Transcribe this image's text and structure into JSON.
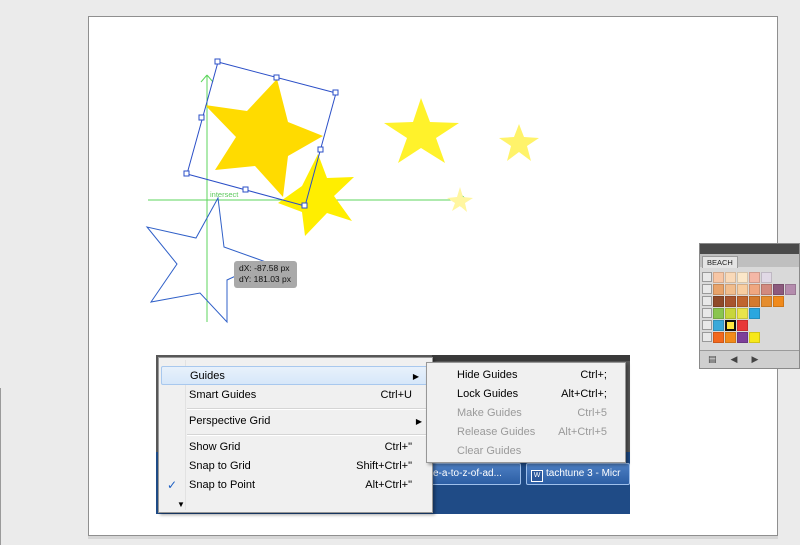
{
  "canvas": {
    "smart_guide_label": "intersect",
    "measure": {
      "dx": "dX: -87.58 px",
      "dy": "dY: 181.03 px"
    }
  },
  "swatches": {
    "tab": "BEACH",
    "rows": [
      [
        "#f7c6a5",
        "#f9d9b8",
        "#fbe7c9",
        "#f4b7a6",
        "#e1d9e6"
      ],
      [
        "#e8a36a",
        "#f1bd8d",
        "#f8cda0",
        "#f0a780",
        "#d28a7f",
        "#8c5a7d",
        "#b48cad"
      ],
      [
        "#8f4a2a",
        "#a8552f",
        "#c0652e",
        "#d37a2e",
        "#e58d2f",
        "#f08a1c"
      ],
      [
        "#8ac54f",
        "#c8d63b",
        "#e9e44b",
        "#2aa7df"
      ],
      [
        "#3aa9d9",
        "#ffe640",
        "#e83838"
      ],
      [
        "#f2681d",
        "#f28b1a",
        "#7c3f99",
        "#f7e81a"
      ]
    ],
    "selected": "4.1"
  },
  "context_menu": {
    "items": {
      "guides": "Guides",
      "smart_guides": "Smart Guides",
      "smart_guides_sc": "Ctrl+U",
      "perspective_grid": "Perspective Grid",
      "show_grid": "Show Grid",
      "show_grid_sc": "Ctrl+\"",
      "snap_to_grid": "Snap to Grid",
      "snap_to_grid_sc": "Shift+Ctrl+\"",
      "snap_to_point": "Snap to Point",
      "snap_to_point_sc": "Alt+Ctrl+\""
    },
    "check": "✓",
    "more": "▼"
  },
  "guides_submenu": {
    "hide_guides": "Hide Guides",
    "hide_guides_sc": "Ctrl+;",
    "lock_guides": "Lock Guides",
    "lock_guides_sc": "Alt+Ctrl+;",
    "make_guides": "Make Guides",
    "make_guides_sc": "Ctrl+5",
    "release_guides": "Release Guides",
    "release_guides_sc": "Alt+Ctrl+5",
    "clear_guides": "Clear Guides"
  },
  "taskbar": {
    "btn1": "e-a-to-z-of-ad...",
    "btn2": "tachtune 3 - Micr"
  },
  "colors": {
    "star_main": "#ffdb00",
    "star_light": "#fff22b",
    "star_pale": "#fff36a",
    "guide": "#5cd65c",
    "bbox": "#2b4fc7"
  }
}
